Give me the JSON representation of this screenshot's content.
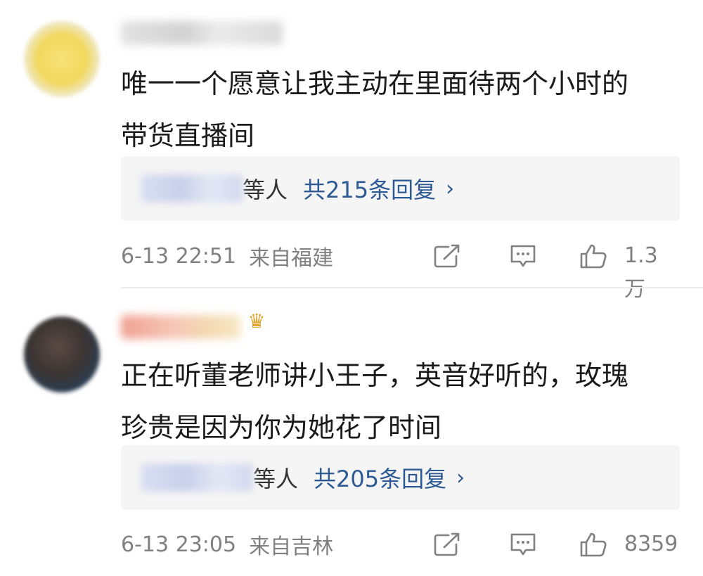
{
  "comments": [
    {
      "text": "唯一一个愿意让我主动在里面待两个小时的\n带货直播间",
      "reply_others": "等人",
      "reply_link": "共215条回复",
      "chevron": "›",
      "time": "6-13 22:51",
      "location": "来自福建",
      "likes": "1.3万"
    },
    {
      "text": "正在听董老师讲小王子，英音好听的，玫瑰\n珍贵是因为你为她花了时间",
      "reply_others": "等人",
      "reply_link": "共205条回复",
      "chevron": "›",
      "time": "6-13 23:05",
      "location": "来自吉林",
      "likes": "8359"
    }
  ],
  "icons": [
    "share-icon",
    "comment-icon",
    "like-icon"
  ],
  "colors": {
    "link": "#2d5a94",
    "meta": "#808080",
    "reply_bg": "#f5f5f5"
  }
}
